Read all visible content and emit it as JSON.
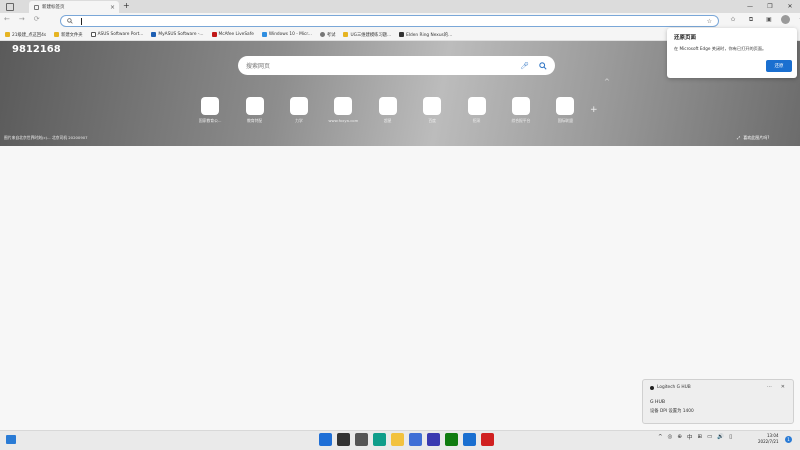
{
  "browser": {
    "tab_title": "新建标签页",
    "tab_close": "×",
    "new_tab": "+",
    "window_controls": [
      "—",
      "❐",
      "✕"
    ],
    "nav_icons": [
      "←",
      "→",
      "⟳"
    ],
    "favorites": [
      {
        "label": "21级建_点这回4s"
      },
      {
        "label": "新建文件夹"
      },
      {
        "label": "ASUS Software Port..."
      },
      {
        "label": "MyASUS Software -..."
      },
      {
        "label": "McAfee LiveSafe"
      },
      {
        "label": "Windows 10 - Micr..."
      },
      {
        "label": "考试"
      },
      {
        "label": "UG三维建模练习题..."
      },
      {
        "label": "Elden Ring Nexus的..."
      }
    ]
  },
  "newtab": {
    "number_text": "9812168",
    "search_placeholder": "搜索网页",
    "quick_links": [
      {
        "label": "国家教育公..."
      },
      {
        "label": "教育特配"
      },
      {
        "label": "力学"
      },
      {
        "label": "www.fxxya.com"
      },
      {
        "label": "超星"
      },
      {
        "label": "百度"
      },
      {
        "label": "招采"
      },
      {
        "label": "综合报平台"
      },
      {
        "label": "国际联盟"
      }
    ],
    "image_caption": "图片来自北京世界时刻(c)... 北京司机 20200907",
    "like_image": "喜欢此图片吗?"
  },
  "restore_popup": {
    "title": "还原页面",
    "message": "在 Microsoft Edge 关闭时，你有已打开的页面。",
    "button": "还原"
  },
  "notification": {
    "app": "Logitech G HUB",
    "title": "G HUB",
    "body": "设备 DPI 设置为 1400",
    "controls": [
      "···",
      "✕"
    ]
  },
  "taskbar": {
    "time": "13:04",
    "date": "2022/7/21",
    "tray_lang": "中",
    "notification_count": "1",
    "tray_icons": [
      "^",
      "◎",
      "⊕",
      "中",
      "⊞",
      "▭",
      "🔊",
      "▯"
    ],
    "colors": {
      "start": "#1f6fd6",
      "search": "#333333",
      "taskview": "#555555",
      "edge": "#0f9d8a",
      "explorer": "#f2c23e",
      "store": "#3f6fd6",
      "mail": "#3a3ab0",
      "xbox": "#107c10",
      "outlook": "#1a6fd0",
      "app": "#d02020"
    }
  },
  "colors": {
    "hero_dark": "#5a5a5a",
    "accent": "#1a6fd0"
  }
}
